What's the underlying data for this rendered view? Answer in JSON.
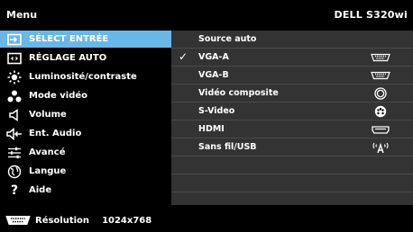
{
  "header": {
    "title": "Menu",
    "model": "DELL S320wi"
  },
  "left_menu": [
    {
      "label": "SÉLECT ENTRÉE",
      "icon": "input-source-icon",
      "selected": true
    },
    {
      "label": "RÉGLAGE AUTO",
      "icon": "auto-adjust-icon"
    },
    {
      "label": "Luminosité/contraste",
      "icon": "brightness-icon"
    },
    {
      "label": "Mode vidéo",
      "icon": "video-mode-icon"
    },
    {
      "label": "Volume",
      "icon": "speaker-icon"
    },
    {
      "label": "Ent. Audio",
      "icon": "audio-input-icon"
    },
    {
      "label": "Avancé",
      "icon": "sliders-icon"
    },
    {
      "label": "Langue",
      "icon": "globe-icon"
    },
    {
      "label": "Aide",
      "icon": "question-icon"
    }
  ],
  "right_menu": [
    {
      "label": "Source auto",
      "checked": false,
      "icon": ""
    },
    {
      "label": "VGA-A",
      "checked": true,
      "icon": "vga-port-icon"
    },
    {
      "label": "VGA-B",
      "checked": false,
      "icon": "vga-port-icon"
    },
    {
      "label": "Vidéo composite",
      "checked": false,
      "icon": "composite-port-icon"
    },
    {
      "label": "S-Video",
      "checked": false,
      "icon": "svideo-port-icon"
    },
    {
      "label": "HDMI",
      "checked": false,
      "icon": "hdmi-port-icon"
    },
    {
      "label": "Sans fil/USB",
      "checked": false,
      "icon": "wireless-icon"
    }
  ],
  "status": {
    "label": "Résolution",
    "value": "1024x768",
    "icon": "vga-port-icon"
  },
  "colors": {
    "highlight": "#69b7e6",
    "panel": "#333333",
    "background": "#000000"
  }
}
